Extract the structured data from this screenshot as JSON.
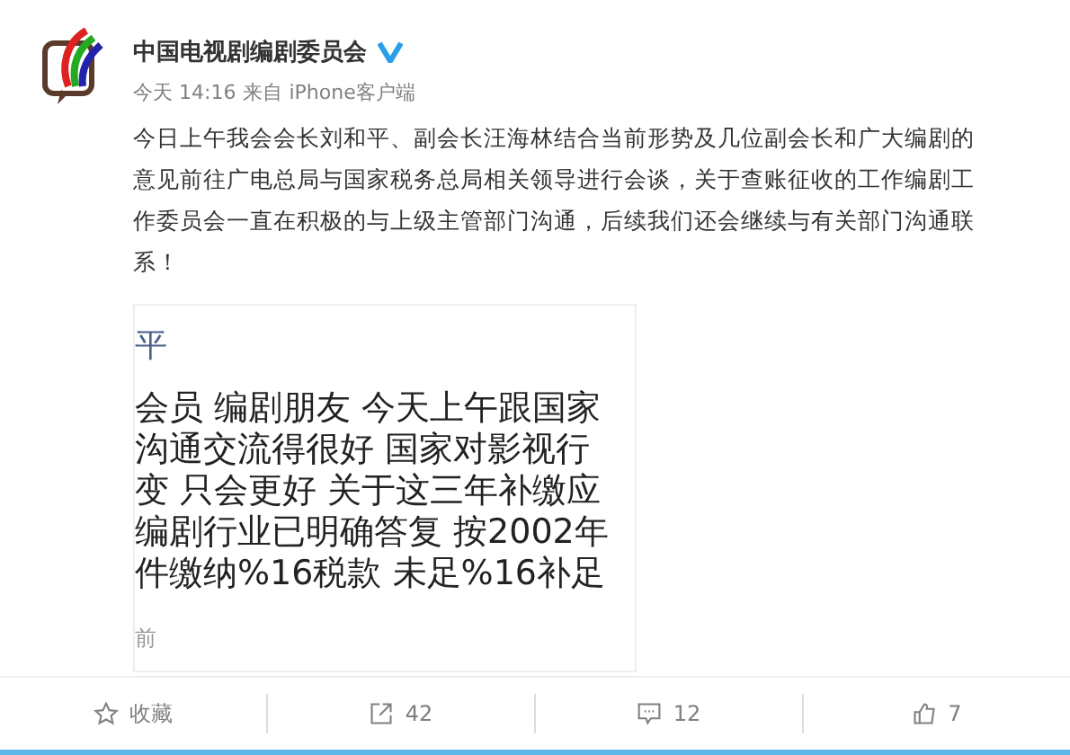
{
  "post": {
    "author": "中国电视剧编剧委员会",
    "verified": true,
    "time": "今天 14:16",
    "source": "来自 iPhone客户端",
    "text": "今日上午我会会长刘和平、副会长汪海林结合当前形势及几位副会长和广大编剧的意见前往广电总局与国家税务总局相关领导进行会谈，关于查账征收的工作编剧工作委员会一直在积极的与上级主管部门沟通，后续我们还会继续与有关部门沟通联系！"
  },
  "attached_image": {
    "name_line": "平",
    "lines": [
      "会员 编剧朋友 今天上午跟国家",
      "沟通交流得很好 国家对影视行",
      "变 只会更好 关于这三年补缴应",
      "编剧行业已明确答复 按2002年",
      "件缴纳%16税款 未足%16补足"
    ],
    "time": "前"
  },
  "actions": [
    {
      "kind": "favorite",
      "label": "收藏"
    },
    {
      "kind": "repost",
      "label": "42"
    },
    {
      "kind": "comment",
      "label": "12"
    },
    {
      "kind": "like",
      "label": "7"
    }
  ]
}
